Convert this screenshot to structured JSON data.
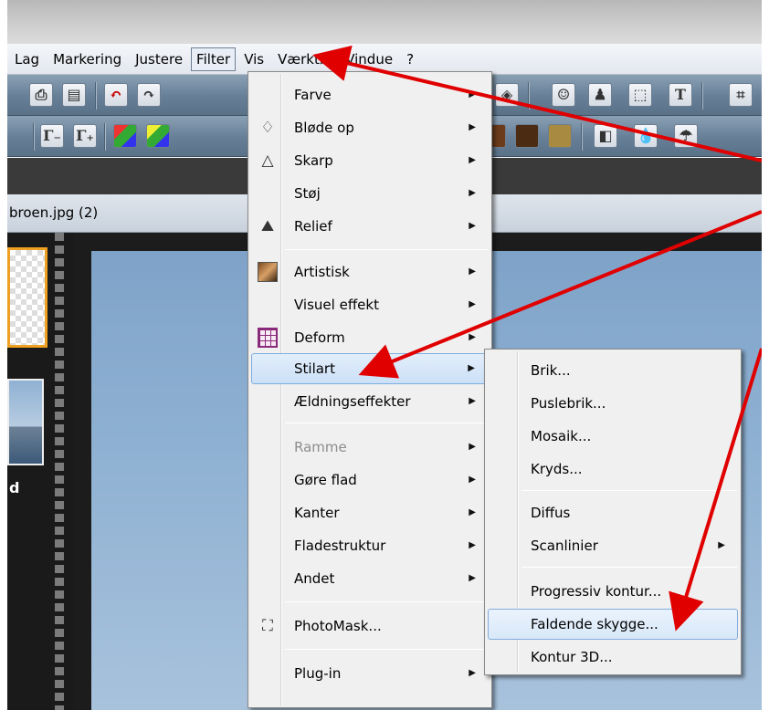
{
  "menubar": {
    "items": [
      "Lag",
      "Markering",
      "Justere",
      "Filter",
      "Vis",
      "Værktøj",
      "Vindue",
      "?"
    ]
  },
  "document_tab": {
    "title": "broen.jpg (2)"
  },
  "filmstrip": {
    "thumb_label": "d"
  },
  "toolbar": {
    "glyphs": [
      "Γ₋",
      "Γ₊",
      "T"
    ]
  },
  "filter_menu": {
    "items": [
      {
        "label": "Farve",
        "icon": "",
        "submenu": true,
        "disabled": false
      },
      {
        "label": "Bløde op",
        "icon": "drop-icon",
        "submenu": true,
        "disabled": false
      },
      {
        "label": "Skarp",
        "icon": "triangle-icon",
        "submenu": true,
        "disabled": false
      },
      {
        "label": "Støj",
        "icon": "",
        "submenu": true,
        "disabled": false
      },
      {
        "label": "Relief",
        "icon": "relief-icon",
        "submenu": true,
        "disabled": false
      },
      {
        "label": "Artistisk",
        "icon": "portrait-icon",
        "submenu": true,
        "disabled": false
      },
      {
        "label": "Visuel effekt",
        "icon": "",
        "submenu": true,
        "disabled": false
      },
      {
        "label": "Deform",
        "icon": "grid-icon",
        "submenu": true,
        "disabled": false
      },
      {
        "label": "Stilart",
        "icon": "",
        "submenu": true,
        "disabled": false,
        "highlighted": true
      },
      {
        "label": "Ældningseffekter",
        "icon": "",
        "submenu": true,
        "disabled": false
      },
      {
        "label": "Ramme",
        "icon": "",
        "submenu": true,
        "disabled": true
      },
      {
        "label": "Gøre flad",
        "icon": "",
        "submenu": true,
        "disabled": false
      },
      {
        "label": "Kanter",
        "icon": "",
        "submenu": true,
        "disabled": false
      },
      {
        "label": "Fladestruktur",
        "icon": "",
        "submenu": true,
        "disabled": false
      },
      {
        "label": "Andet",
        "icon": "",
        "submenu": true,
        "disabled": false
      },
      {
        "label": "PhotoMask...",
        "icon": "photomask-icon",
        "submenu": false,
        "disabled": false
      },
      {
        "label": "Plug-in",
        "icon": "",
        "submenu": true,
        "disabled": false
      }
    ]
  },
  "stilart_menu": {
    "items": [
      {
        "label": "Brik...",
        "submenu": false
      },
      {
        "label": "Puslebrik...",
        "submenu": false
      },
      {
        "label": "Mosaik...",
        "submenu": false
      },
      {
        "label": "Kryds...",
        "submenu": false
      },
      {
        "label": "Diffus",
        "submenu": false
      },
      {
        "label": "Scanlinier",
        "submenu": true
      },
      {
        "label": "Progressiv kontur...",
        "submenu": false
      },
      {
        "label": "Faldende skygge...",
        "submenu": false,
        "highlighted": true
      },
      {
        "label": "Kontur 3D...",
        "submenu": false
      }
    ]
  },
  "colors": {
    "annotation_arrow": "#e00000",
    "highlight": "#cce0f7"
  },
  "submenu_arrow": "▶"
}
